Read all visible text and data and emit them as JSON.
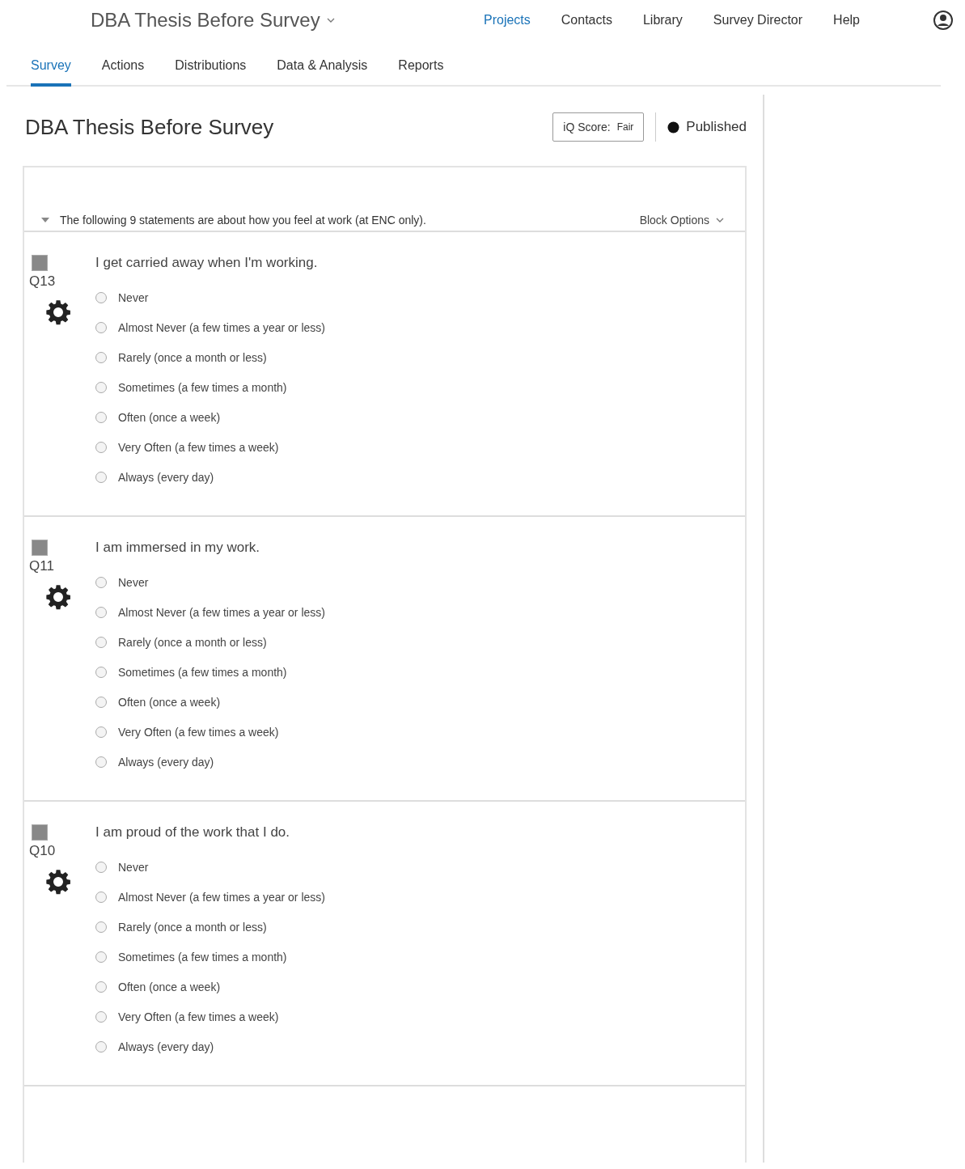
{
  "header": {
    "project_title": "DBA Thesis Before Survey",
    "nav": [
      {
        "label": "Projects",
        "selected": true
      },
      {
        "label": "Contacts",
        "selected": false
      },
      {
        "label": "Library",
        "selected": false
      },
      {
        "label": "Survey Director",
        "selected": false
      },
      {
        "label": "Help",
        "selected": false
      }
    ]
  },
  "tabs": [
    {
      "label": "Survey",
      "selected": true
    },
    {
      "label": "Actions",
      "selected": false
    },
    {
      "label": "Distributions",
      "selected": false
    },
    {
      "label": "Data & Analysis",
      "selected": false
    },
    {
      "label": "Reports",
      "selected": false
    }
  ],
  "survey": {
    "title": "DBA Thesis Before Survey",
    "iq_score_label": "iQ Score:",
    "iq_score_value": "Fair",
    "status": "Published"
  },
  "block": {
    "expanded": true,
    "description": "The following 9 statements are about how you feel at work (at ENC only).",
    "options_label": "Block Options"
  },
  "questions": [
    {
      "number": "Q13",
      "checked": false,
      "text": "I get carried away when I'm working.",
      "choices": [
        {
          "label": "Never",
          "selected": false
        },
        {
          "label": "Almost Never (a few times a year or less)",
          "selected": false
        },
        {
          "label": "Rarely (once a month or less)",
          "selected": false
        },
        {
          "label": "Sometimes (a few times a month)",
          "selected": false
        },
        {
          "label": "Often (once a week)",
          "selected": false
        },
        {
          "label": "Very Often (a few times a week)",
          "selected": false
        },
        {
          "label": "Always (every day)",
          "selected": false
        }
      ]
    },
    {
      "number": "Q11",
      "checked": false,
      "text": "I am immersed in my work.",
      "choices": [
        {
          "label": "Never",
          "selected": false
        },
        {
          "label": "Almost Never (a few times a year or less)",
          "selected": false
        },
        {
          "label": "Rarely (once a month or less)",
          "selected": false
        },
        {
          "label": "Sometimes (a few times a month)",
          "selected": false
        },
        {
          "label": "Often (once a week)",
          "selected": false
        },
        {
          "label": "Very Often (a few times a week)",
          "selected": false
        },
        {
          "label": "Always (every day)",
          "selected": false
        }
      ]
    },
    {
      "number": "Q10",
      "checked": false,
      "text": "I am proud of the work that I do.",
      "choices": [
        {
          "label": "Never",
          "selected": false
        },
        {
          "label": "Almost Never (a few times a year or less)",
          "selected": false
        },
        {
          "label": "Rarely (once a month or less)",
          "selected": false
        },
        {
          "label": "Sometimes (a few times a month)",
          "selected": false
        },
        {
          "label": "Often (once a week)",
          "selected": false
        },
        {
          "label": "Very Often (a few times a week)",
          "selected": false
        },
        {
          "label": "Always (every day)",
          "selected": false
        }
      ]
    }
  ]
}
